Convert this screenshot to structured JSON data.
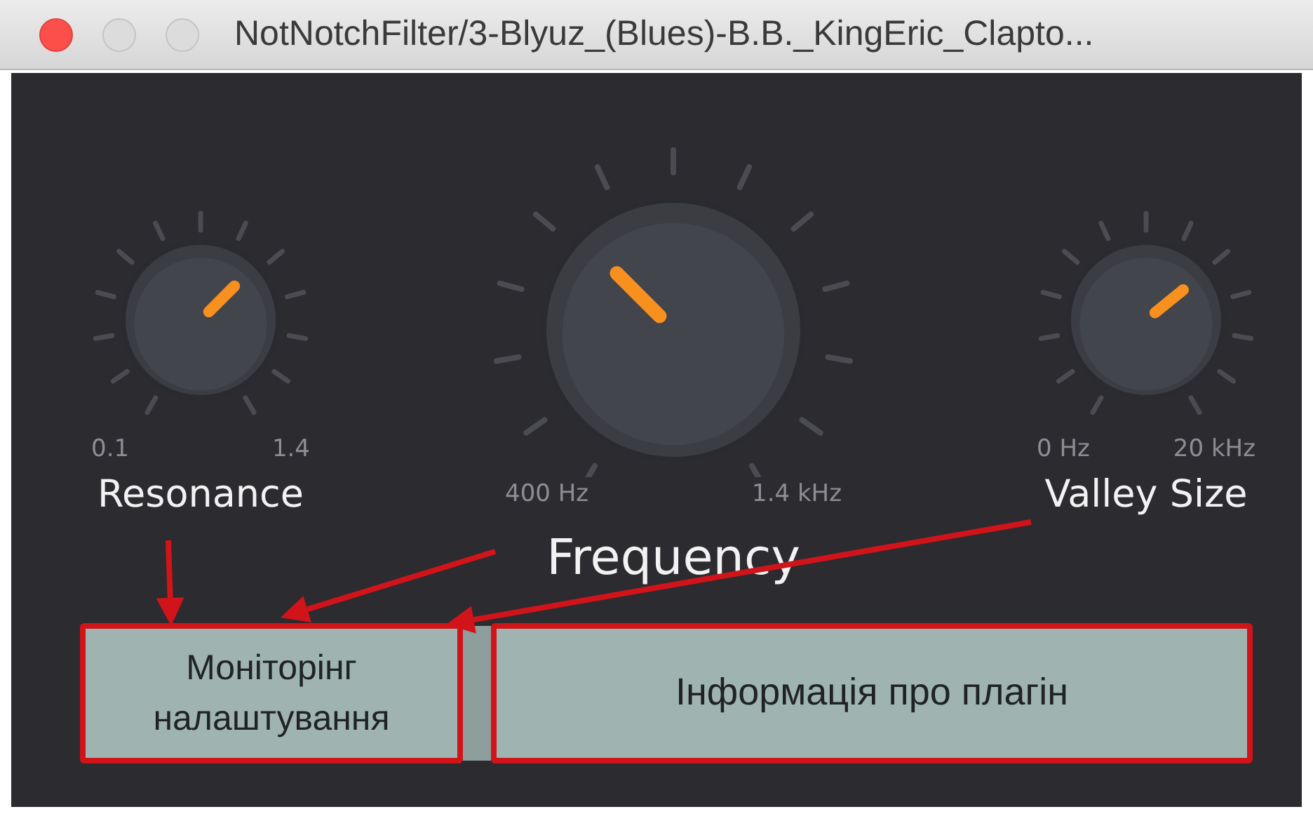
{
  "window": {
    "title": "NotNotchFilter/3-Blyuz_(Blues)-B.B._KingEric_Clapto..."
  },
  "knobs": [
    {
      "kind": "small",
      "label": "Resonance",
      "min": "0.1",
      "max": "1.4"
    },
    {
      "kind": "large",
      "label": "Frequency",
      "min": "400 Hz",
      "max": "1.4 kHz"
    },
    {
      "kind": "small",
      "label": "Valley Size",
      "min": "0 Hz",
      "max": "20 kHz"
    }
  ],
  "buttons": [
    {
      "label": "Моніторінг налаштування",
      "highlighted": true
    },
    {
      "label": "Інформація про плагін",
      "highlighted": true
    }
  ]
}
